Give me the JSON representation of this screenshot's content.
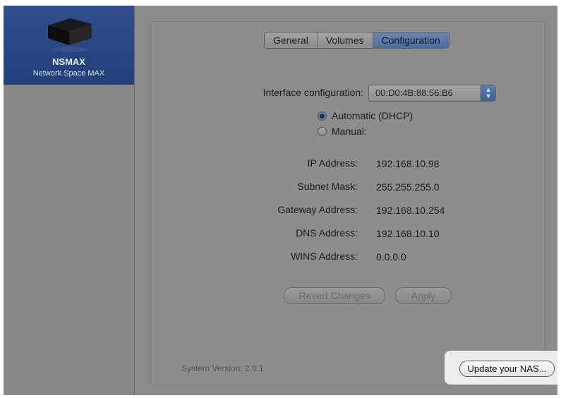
{
  "sidebar": {
    "device": {
      "name": "NSMAX",
      "subtitle": "Network Space MAX",
      "icon": "nas-drive-icon"
    }
  },
  "tabs": [
    {
      "label": "General",
      "active": false
    },
    {
      "label": "Volumes",
      "active": false
    },
    {
      "label": "Configuration",
      "active": true
    }
  ],
  "config": {
    "interface_label": "Interface configuration:",
    "interface_value": "00:D0:4B:88:56:B6",
    "mode_options": [
      {
        "label": "Automatic (DHCP)",
        "selected": true
      },
      {
        "label": "Manual:",
        "selected": false
      }
    ],
    "fields": [
      {
        "label": "IP Address:",
        "value": "192.168.10.98"
      },
      {
        "label": "Subnet Mask:",
        "value": "255.255.255.0"
      },
      {
        "label": "Gateway Address:",
        "value": "192.168.10.254"
      },
      {
        "label": "DNS Address:",
        "value": "192.168.10.10"
      },
      {
        "label": "WINS Address:",
        "value": "0.0.0.0"
      }
    ],
    "revert_label": "Revert Changes",
    "apply_label": "Apply"
  },
  "footer": {
    "version": "System Version: 2.0.1",
    "update_label": "Update your NAS..."
  },
  "colors": {
    "selection": "#2f4f8c",
    "highlight": "#ececec"
  }
}
